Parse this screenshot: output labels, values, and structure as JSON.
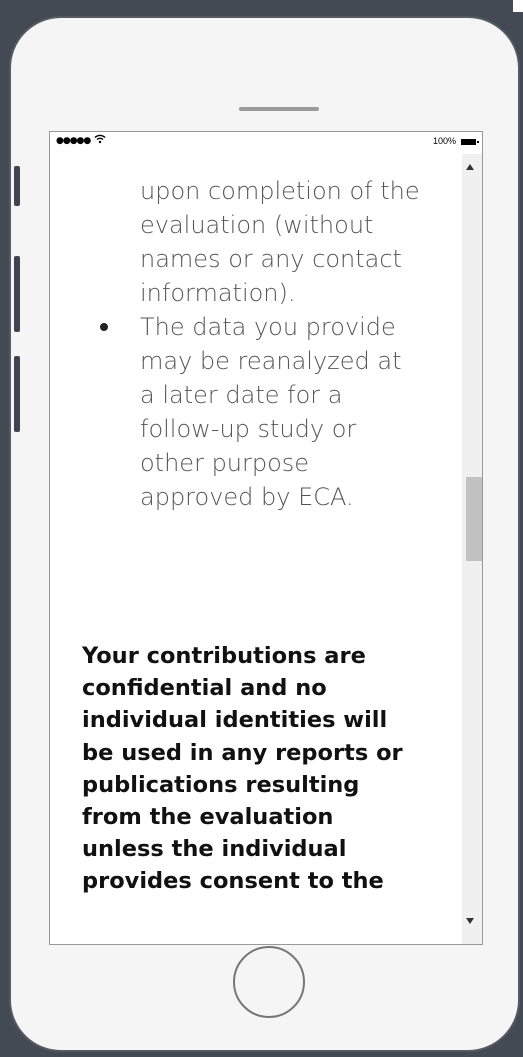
{
  "status_bar": {
    "signal": "●●●●●",
    "wifi": "wifi-icon",
    "battery_label": "100%"
  },
  "bullets": [
    {
      "lines": [
        "upon completion of the",
        "evaluation (without",
        "names or any contact",
        "information)."
      ]
    },
    {
      "lines": [
        "The data you provide",
        "may be reanalyzed at",
        "a later date for a",
        "follow-up study or",
        "other purpose",
        "approved by ECA."
      ]
    }
  ],
  "notice": {
    "lines": [
      "Your contributions are",
      "confidential and no",
      "individual identities will",
      "be used in any reports or",
      "publications resulting",
      "from the evaluation",
      "unless the individual",
      "provides consent to the"
    ]
  },
  "colors": {
    "frame_background": "#434a54",
    "phone_body": "#f5f5f5",
    "body_text": "#555555",
    "notice_text": "#111111"
  },
  "scroll": {
    "position_fraction": 0.41
  }
}
